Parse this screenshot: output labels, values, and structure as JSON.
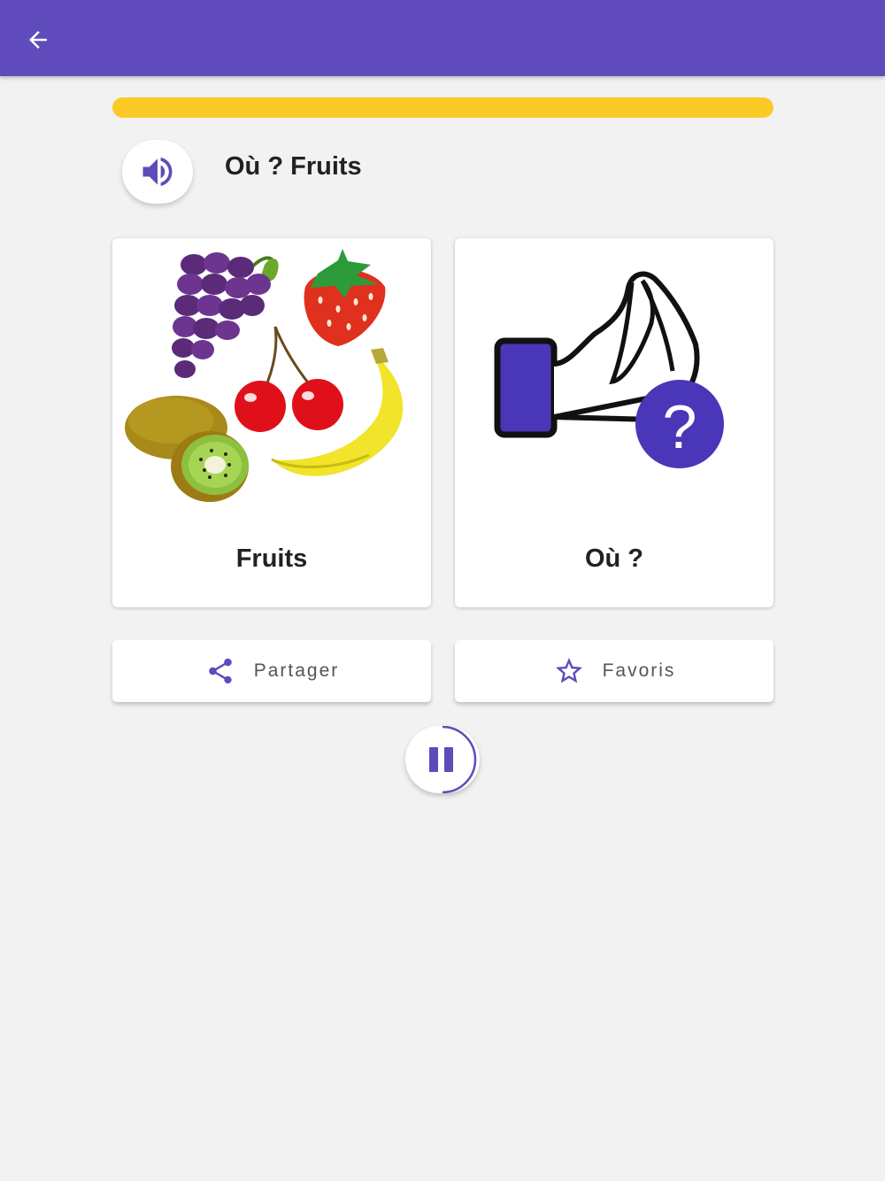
{
  "appbar": {
    "back_icon": "arrow-left-icon",
    "color": "#5f4bbb"
  },
  "progress": {
    "value": 1.0,
    "color": "#fcca26"
  },
  "phrase": {
    "speak_icon": "speaker-icon",
    "title": "Où ? Fruits"
  },
  "cards": [
    {
      "label": "Fruits",
      "image": "fruits-picture"
    },
    {
      "label": "Où ?",
      "image": "where-hand-question-picture"
    }
  ],
  "actions": {
    "share": {
      "label": "Partager",
      "icon": "share-icon"
    },
    "favorites": {
      "label": "Favoris",
      "icon": "star-outline-icon"
    }
  },
  "player": {
    "pause_icon": "pause-icon",
    "progress": 0.5,
    "accent": "#5f4bbb"
  }
}
